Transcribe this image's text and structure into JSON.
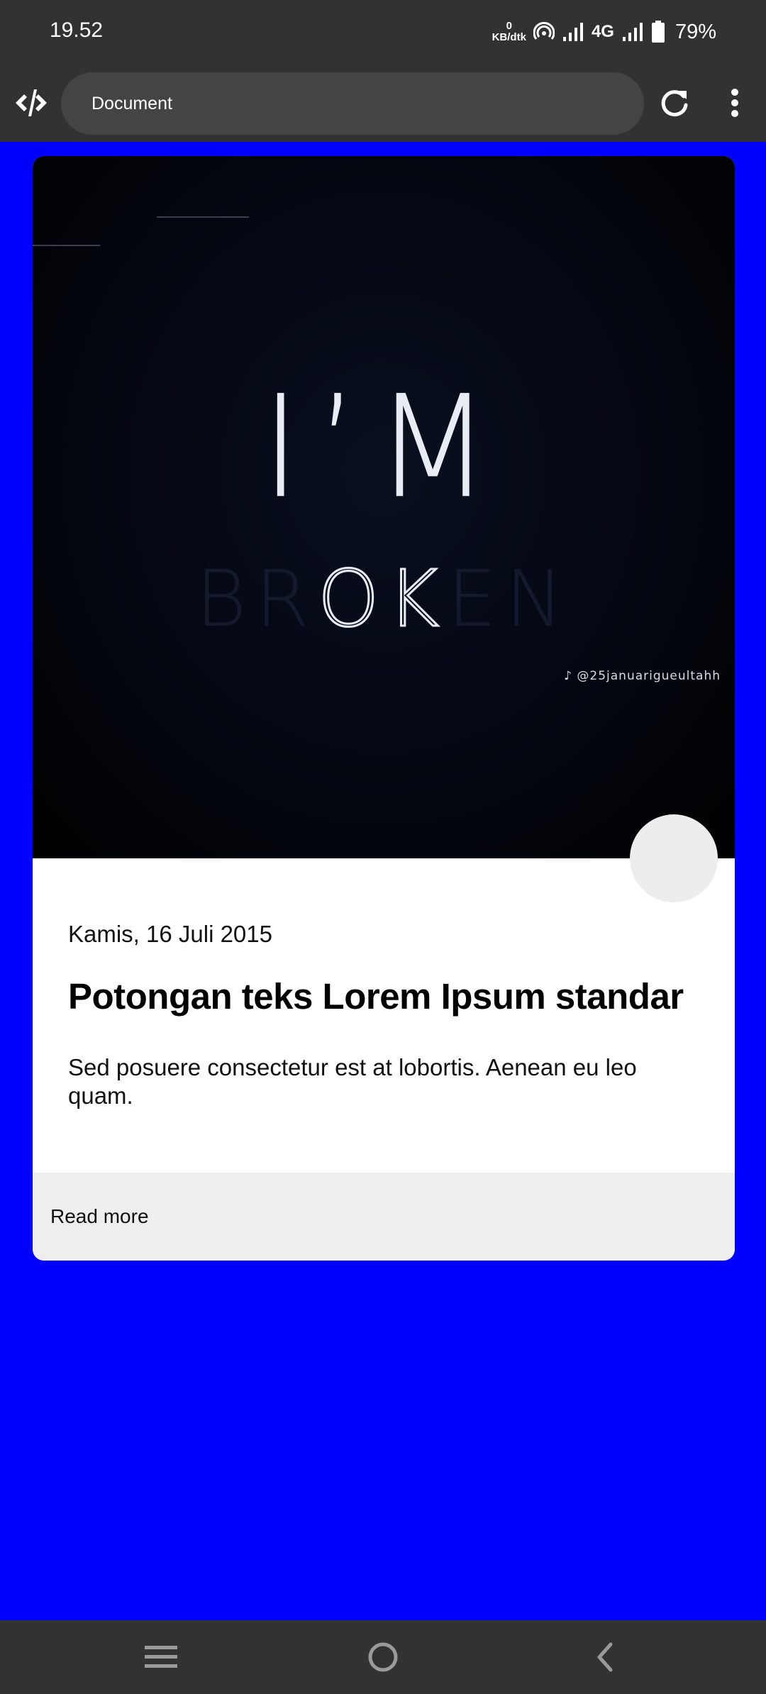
{
  "status_bar": {
    "time": "19.52",
    "net_speed_value": "0",
    "net_speed_unit": "KB/dtk",
    "network_type": "4G",
    "battery_percent": "79%"
  },
  "browser": {
    "url_text": "Document"
  },
  "card": {
    "image": {
      "line1": "I’M",
      "line2_faint_left": "BR",
      "line2_bright": "OK",
      "line2_faint_right": "EN",
      "watermark": "♪ @25januarigueultahh"
    },
    "date": "Kamis, 16 Juli 2015",
    "title": "Potongan teks Lorem Ipsum standar",
    "body": "Sed posuere consectetur est at lobortis. Aenean eu leo quam.",
    "footer_link": "Read more"
  },
  "colors": {
    "page_background": "#0000ff",
    "system_bar": "#323232",
    "url_bar": "#444444",
    "card_background": "#ffffff",
    "card_footer": "#eeeeee",
    "avatar": "#ededed"
  }
}
